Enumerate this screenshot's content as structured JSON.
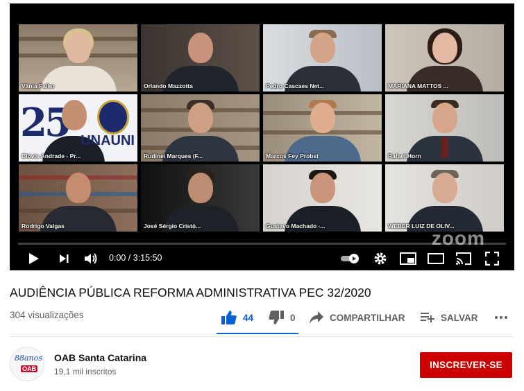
{
  "player": {
    "participants": [
      {
        "name": "Vânia Faller",
        "active": false
      },
      {
        "name": "Orlando Mazzotta",
        "active": false
      },
      {
        "name": "Pedro Cascaes Net...",
        "active": false
      },
      {
        "name": "MARIANA MATTOS ...",
        "active": true
      },
      {
        "name": "Clóvis Andrade - Pr...",
        "active": false
      },
      {
        "name": "Rudinei Marques (F...",
        "active": false
      },
      {
        "name": "Marcos Fey Probst",
        "active": false
      },
      {
        "name": "Rafael Horn",
        "active": false
      },
      {
        "name": "Rodrigo Valgas",
        "active": false
      },
      {
        "name": "José Sérgio Cristó...",
        "active": false
      },
      {
        "name": "Gustavo Machado -...",
        "active": false
      },
      {
        "name": "WEBER LUIZ DE OLIV...",
        "active": false
      }
    ],
    "watermark": "zoom",
    "logo_tile_text": {
      "big": "25",
      "right": "UNAUNI"
    },
    "time": "0:00 / 3:15:50",
    "progress": 0.0,
    "accent_active_color": "#7ec845"
  },
  "video": {
    "title": "AUDIÊNCIA PÚBLICA REFORMA ADMINISTRATIVA PEC 32/2020",
    "views": "304 visualizações"
  },
  "actions": {
    "likes": "44",
    "dislikes": "0",
    "share_label": "COMPARTILHAR",
    "save_label": "SALVAR",
    "like_color": "#065fd4"
  },
  "channel": {
    "name": "OAB Santa Catarina",
    "subscribers": "19,1 mil inscritos",
    "avatar_text_top": "88anos",
    "avatar_text_bottom": "OAB",
    "subscribe_label": "INSCREVER-SE",
    "subscribe_color": "#cc0000"
  }
}
